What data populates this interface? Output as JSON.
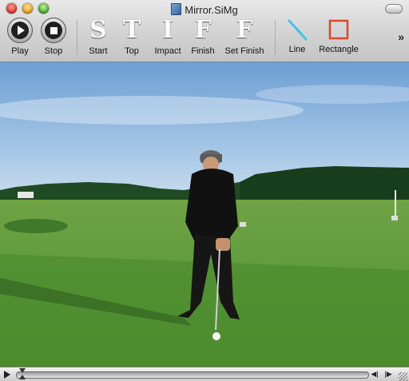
{
  "window": {
    "title": "Mirror.SiMg"
  },
  "toolbar": {
    "play_label": "Play",
    "stop_label": "Stop",
    "stiff": [
      {
        "letter": "S",
        "label": "Start"
      },
      {
        "letter": "T",
        "label": "Top"
      },
      {
        "letter": "I",
        "label": "Impact"
      },
      {
        "letter": "F",
        "label": "Finish"
      },
      {
        "letter": "F",
        "label": "Set Finish"
      }
    ],
    "line_label": "Line",
    "rectangle_label": "Rectangle",
    "overflow_glyph": "»"
  },
  "controller": {
    "play_glyph": "",
    "step_back_glyph": "◀|",
    "step_forward_glyph": "|▶",
    "playhead_position": 0.01
  },
  "colors": {
    "line_tool": "#3fc4e6",
    "rectangle_tool": "#d8482a",
    "sky": "#8ab4dd",
    "grass": "#5f9a3b"
  }
}
